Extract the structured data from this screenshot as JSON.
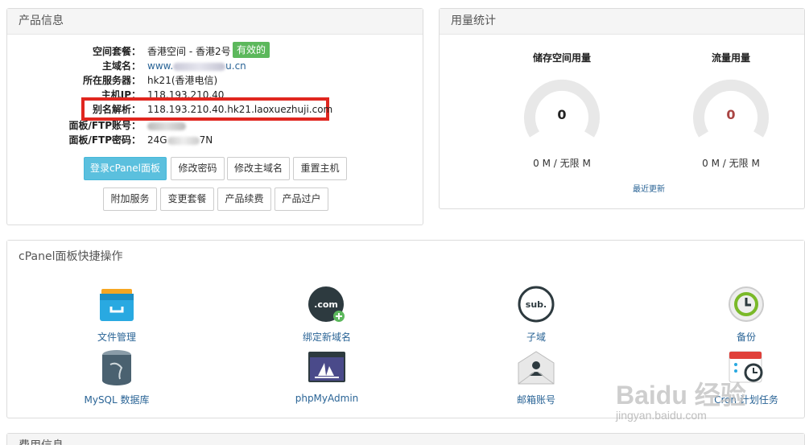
{
  "product_info": {
    "title": "产品信息",
    "rows": [
      {
        "label": "空间套餐：",
        "value": "香港空间 - 香港2号"
      },
      {
        "label": "主域名：",
        "value": "www.",
        "value_suffix": "u.cn"
      },
      {
        "label": "所在服务器：",
        "value": "hk21(香港电信)"
      },
      {
        "label": "主机IP：",
        "value": "118.193.210.40"
      },
      {
        "label": "别名解析：",
        "value": "118.193.210.40.hk21.laoxuezhuji.com"
      },
      {
        "label": "面板/FTP账号：",
        "value": ""
      },
      {
        "label": "面板/FTP密码：",
        "value": "24G",
        "value_suffix": "7N"
      }
    ],
    "status_badge": "有效的",
    "buttons_row1": [
      "登录cPanel面板",
      "修改密码",
      "修改主域名",
      "重置主机"
    ],
    "buttons_row2": [
      "附加服务",
      "变更套餐",
      "产品续费",
      "产品过户"
    ]
  },
  "usage": {
    "title": "用量统计",
    "storage": {
      "title": "储存空间用量",
      "value": "0",
      "sub": "0 M / 无限 M"
    },
    "traffic": {
      "title": "流量用量",
      "value": "0",
      "sub": "0 M / 无限 M"
    },
    "recent_link": "最近更新",
    "colors": {
      "gauge": "#e8e8e8",
      "storage_num": "#222222",
      "traffic_num": "#a94442"
    }
  },
  "cpanel": {
    "title": "cPanel面板快捷操作",
    "items": [
      {
        "label": "文件管理",
        "icon": "file-manager-icon"
      },
      {
        "label": "绑定新域名",
        "icon": "addon-domain-icon",
        "icon_text": ".com"
      },
      {
        "label": "子域",
        "icon": "subdomain-icon",
        "icon_text": "sub."
      },
      {
        "label": "备份",
        "icon": "backup-icon"
      },
      {
        "label": "MySQL 数据库",
        "icon": "mysql-icon"
      },
      {
        "label": "phpMyAdmin",
        "icon": "phpmyadmin-icon"
      },
      {
        "label": "邮箱账号",
        "icon": "email-accounts-icon"
      },
      {
        "label": "Cron 计划任务",
        "icon": "cron-jobs-icon"
      }
    ]
  },
  "bottom_panel": {
    "title": "费用信息"
  },
  "watermark": {
    "brand": "Baidu 经验",
    "url": "jingyan.baidu.com"
  }
}
